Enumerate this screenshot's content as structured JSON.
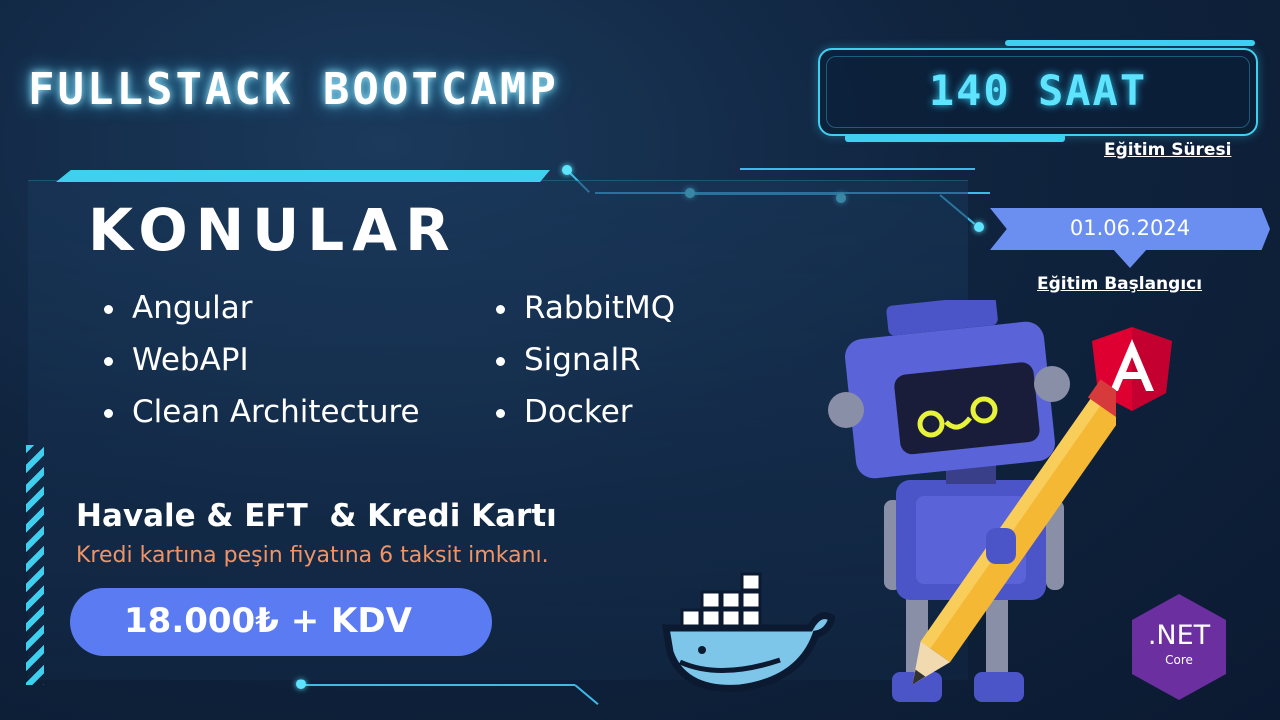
{
  "header": {
    "title": "FULLSTACK BOOTCAMP"
  },
  "duration": {
    "value": "140 SAAT",
    "label": "Eğitim Süresi"
  },
  "start": {
    "date": "01.06.2024",
    "label": "Eğitim Başlangıcı"
  },
  "topics": {
    "heading": "KONULAR",
    "left": [
      "Angular",
      "WebAPI",
      "Clean Architecture"
    ],
    "right": [
      "RabbitMQ",
      "SignalR",
      "Docker"
    ]
  },
  "payment": {
    "methods": "Havale & EFT  & Kredi Kartı",
    "installment_note": "Kredi kartına peşin fiyatına 6 taksit imkanı.",
    "price": "18.000₺ + KDV"
  },
  "logos": {
    "angular_letter": "A",
    "dotnet_main": ".NET",
    "dotnet_sub": "Core",
    "angular_icon": "angular-logo",
    "dotnet_icon": "dotnet-logo",
    "docker_icon": "docker-whale"
  },
  "colors": {
    "accent_cyan": "#3fd0f0",
    "price_pill": "#5b7bf2",
    "installment_text": "#ef9466",
    "angular_red": "#dd0031",
    "dotnet_purple": "#6b2fa0"
  }
}
